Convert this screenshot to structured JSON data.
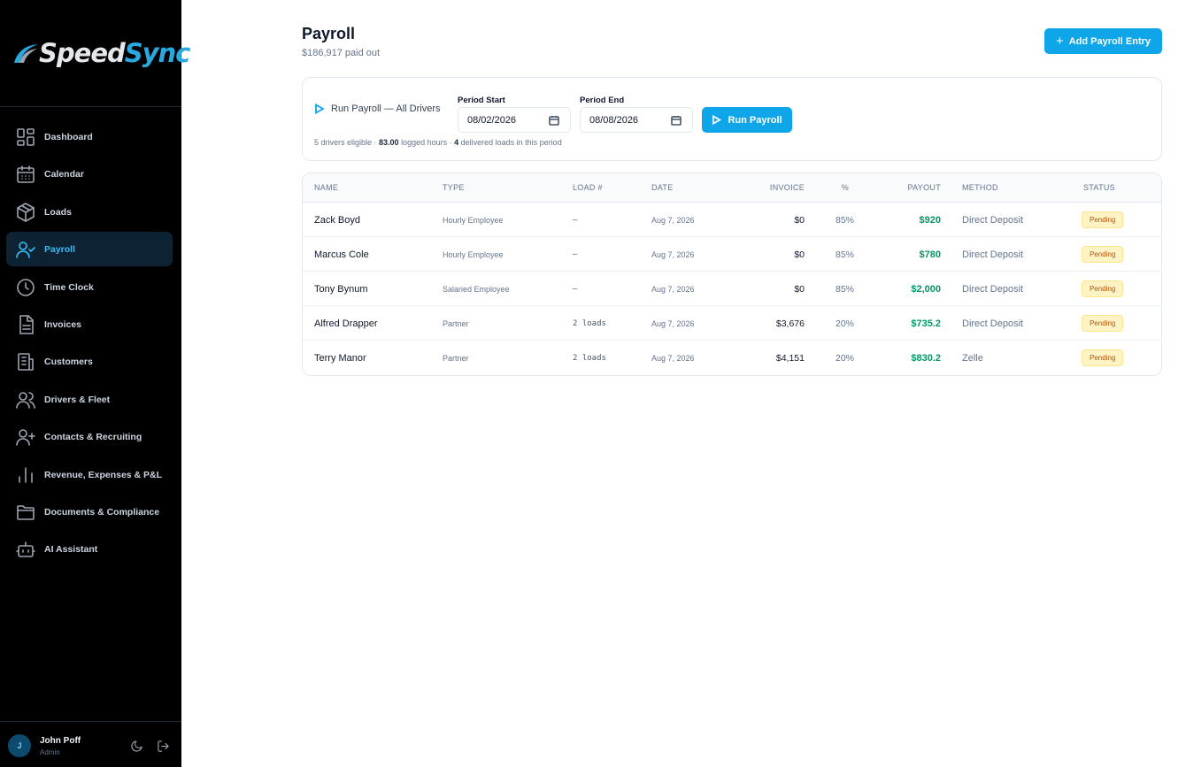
{
  "brand": {
    "name_part1": "Speed",
    "name_part2": "Sync"
  },
  "sidebar": {
    "items": [
      {
        "label": "Dashboard",
        "icon": "dashboard-icon"
      },
      {
        "label": "Calendar",
        "icon": "calendar-icon"
      },
      {
        "label": "Loads",
        "icon": "box-icon"
      },
      {
        "label": "Payroll",
        "icon": "user-check-icon",
        "active": true
      },
      {
        "label": "Time Clock",
        "icon": "clock-icon"
      },
      {
        "label": "Invoices",
        "icon": "document-icon"
      },
      {
        "label": "Customers",
        "icon": "building-icon"
      },
      {
        "label": "Drivers & Fleet",
        "icon": "users-icon"
      },
      {
        "label": "Contacts & Recruiting",
        "icon": "user-plus-icon"
      },
      {
        "label": "Revenue, Expenses & P&L",
        "icon": "bar-chart-icon"
      },
      {
        "label": "Documents & Compliance",
        "icon": "folder-icon"
      },
      {
        "label": "AI Assistant",
        "icon": "bot-icon"
      }
    ]
  },
  "user": {
    "initial": "J",
    "name": "John Poff",
    "role": "Admin"
  },
  "header": {
    "title": "Payroll",
    "subtitle": "$186,917 paid out",
    "add_label": "Add Payroll Entry"
  },
  "run": {
    "title": "Run Payroll — All Drivers",
    "period_start_label": "Period Start",
    "period_start": "08/02/2026",
    "period_end_label": "Period End",
    "period_end": "08/08/2026",
    "button_label": "Run Payroll",
    "note_drivers": "5 drivers eligible · ",
    "note_hours": "83.00",
    "note_mid": " logged hours · ",
    "note_loads": "4",
    "note_end": " delivered loads in this period"
  },
  "table": {
    "headers": {
      "name": "NAME",
      "type": "TYPE",
      "load": "LOAD #",
      "date": "DATE",
      "invoice": "INVOICE",
      "pct": "%",
      "payout": "PAYOUT",
      "method": "METHOD",
      "status": "STATUS"
    },
    "rows": [
      {
        "name": "Zack Boyd",
        "type": "Hourly Employee",
        "load": "—",
        "date": "Aug 7, 2026",
        "invoice": "$0",
        "pct": "85%",
        "payout": "$920",
        "method": "Direct Deposit",
        "status": "Pending"
      },
      {
        "name": "Marcus Cole",
        "type": "Hourly Employee",
        "load": "—",
        "date": "Aug 7, 2026",
        "invoice": "$0",
        "pct": "85%",
        "payout": "$780",
        "method": "Direct Deposit",
        "status": "Pending"
      },
      {
        "name": "Tony Bynum",
        "type": "Salaried Employee",
        "load": "—",
        "date": "Aug 7, 2026",
        "invoice": "$0",
        "pct": "85%",
        "payout": "$2,000",
        "method": "Direct Deposit",
        "status": "Pending"
      },
      {
        "name": "Alfred Drapper",
        "type": "Partner",
        "load": "2 loads",
        "date": "Aug 7, 2026",
        "invoice": "$3,676",
        "pct": "20%",
        "payout": "$735.2",
        "method": "Direct Deposit",
        "status": "Pending"
      },
      {
        "name": "Terry Manor",
        "type": "Partner",
        "load": "2 loads",
        "date": "Aug 7, 2026",
        "invoice": "$4,151",
        "pct": "20%",
        "payout": "$830.2",
        "method": "Zelle",
        "status": "Pending"
      }
    ]
  },
  "colors": {
    "accent": "#0ea5e9",
    "payout": "#059669",
    "sidebar_bg": "#000000",
    "pending_bg": "#fdf3c4"
  }
}
